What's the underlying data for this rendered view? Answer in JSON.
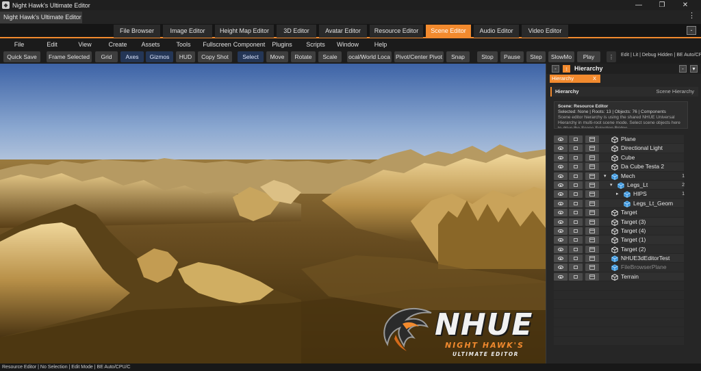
{
  "window": {
    "title": "Night Hawk's Ultimate Editor",
    "document_tab": "Night Hawk's Ultimate Editor",
    "controls": {
      "minimize": "—",
      "maximize": "❐",
      "close": "✕"
    },
    "more_icon": "⋮"
  },
  "editor_tabs": [
    {
      "label": "File Browser",
      "active": false
    },
    {
      "label": "Image Editor",
      "active": false
    },
    {
      "label": "Height Map Editor",
      "active": false
    },
    {
      "label": "3D Editor",
      "active": false
    },
    {
      "label": "Avatar Editor",
      "active": false
    },
    {
      "label": "Resource Editor",
      "active": false
    },
    {
      "label": "Scene Editor",
      "active": true
    },
    {
      "label": "Audio Editor",
      "active": false
    },
    {
      "label": "Video Editor",
      "active": false
    }
  ],
  "tabs_collapse_label": "-",
  "menu": [
    "File",
    "Edit",
    "View",
    "Create",
    "Assets",
    "Tools",
    "Fullscreen",
    "Component",
    "Plugins",
    "Scripts",
    "Window",
    "Help"
  ],
  "toolbar": {
    "buttons": [
      "Quick Save",
      "Frame Selected",
      "Grid",
      "Axes",
      "Gizmos",
      "HUD",
      "Copy Shot",
      "Select",
      "Move",
      "Rotate",
      "Scale",
      "ocal/World Loca",
      "Pivot/Center Pivot",
      "Snap",
      "Stop",
      "Pause",
      "Step",
      "SlowMo",
      "Play"
    ],
    "extra_icon": "⋮",
    "status": "Edit | Lit | Debug Hidden | BE Auto/CPU/"
  },
  "logo": {
    "brand": "NHUE",
    "line1": "NIGHT HAWK'S",
    "line2": "ULTIMATE EDITOR"
  },
  "hierarchy": {
    "collapse_label": "-",
    "title": "Hierarchy",
    "tab_label": "Hierarchy",
    "tab_close": "X",
    "head_btn_1": "-",
    "head_btn_2": "▾",
    "sub_left": "Hierarchy",
    "sub_right": "Scene Hierarchy",
    "info_title": "Scene: Resource Editor",
    "info_stats": "Selected: None  |  Roots: 13  |  Objects: 76  |  Components",
    "info_desc": "Scene editor hierarchy is using the shared NHUE Universal Hierarchy in multi-root scene mode. Select scene objects here to drive the Scene Selection Bridge.",
    "items": [
      {
        "label": "Plane",
        "depth": 0,
        "caret": "",
        "count": "",
        "color": "white",
        "dim": false
      },
      {
        "label": "Directional Light",
        "depth": 0,
        "caret": "",
        "count": "",
        "color": "white",
        "dim": false
      },
      {
        "label": "Cube",
        "depth": 0,
        "caret": "",
        "count": "",
        "color": "white",
        "dim": false
      },
      {
        "label": "Da Cube Testa 2",
        "depth": 0,
        "caret": "",
        "count": "",
        "color": "white",
        "dim": false
      },
      {
        "label": "Mech",
        "depth": 0,
        "caret": "▾",
        "count": "1",
        "color": "blue",
        "dim": false
      },
      {
        "label": "Legs_Lt",
        "depth": 1,
        "caret": "▾",
        "count": "2",
        "color": "blue",
        "dim": false
      },
      {
        "label": "HIPS",
        "depth": 2,
        "caret": "▸",
        "count": "1",
        "color": "blue",
        "dim": false
      },
      {
        "label": "Legs_Lt_Geom",
        "depth": 2,
        "caret": "",
        "count": "",
        "color": "blue",
        "dim": false
      },
      {
        "label": "Target",
        "depth": 0,
        "caret": "",
        "count": "",
        "color": "white",
        "dim": false
      },
      {
        "label": "Target (3)",
        "depth": 0,
        "caret": "",
        "count": "",
        "color": "white",
        "dim": false
      },
      {
        "label": "Target (4)",
        "depth": 0,
        "caret": "",
        "count": "",
        "color": "white",
        "dim": false
      },
      {
        "label": "Target (1)",
        "depth": 0,
        "caret": "",
        "count": "",
        "color": "white",
        "dim": false
      },
      {
        "label": "Target (2)",
        "depth": 0,
        "caret": "",
        "count": "",
        "color": "white",
        "dim": false
      },
      {
        "label": "NHUE3dEditorTest",
        "depth": 0,
        "caret": "",
        "count": "",
        "color": "blue",
        "dim": false
      },
      {
        "label": "FileBrowserPlane",
        "depth": 0,
        "caret": "",
        "count": "",
        "color": "blue",
        "dim": true
      },
      {
        "label": "Terrain",
        "depth": 0,
        "caret": "",
        "count": "",
        "color": "white",
        "dim": false
      }
    ]
  },
  "statusbar": "Resource Editor | No Selection | Edit Mode | BE Auto/CPU/C",
  "colors": {
    "accent": "#f28a2e",
    "panel": "#262626",
    "toolbar_blue": "#243656"
  }
}
